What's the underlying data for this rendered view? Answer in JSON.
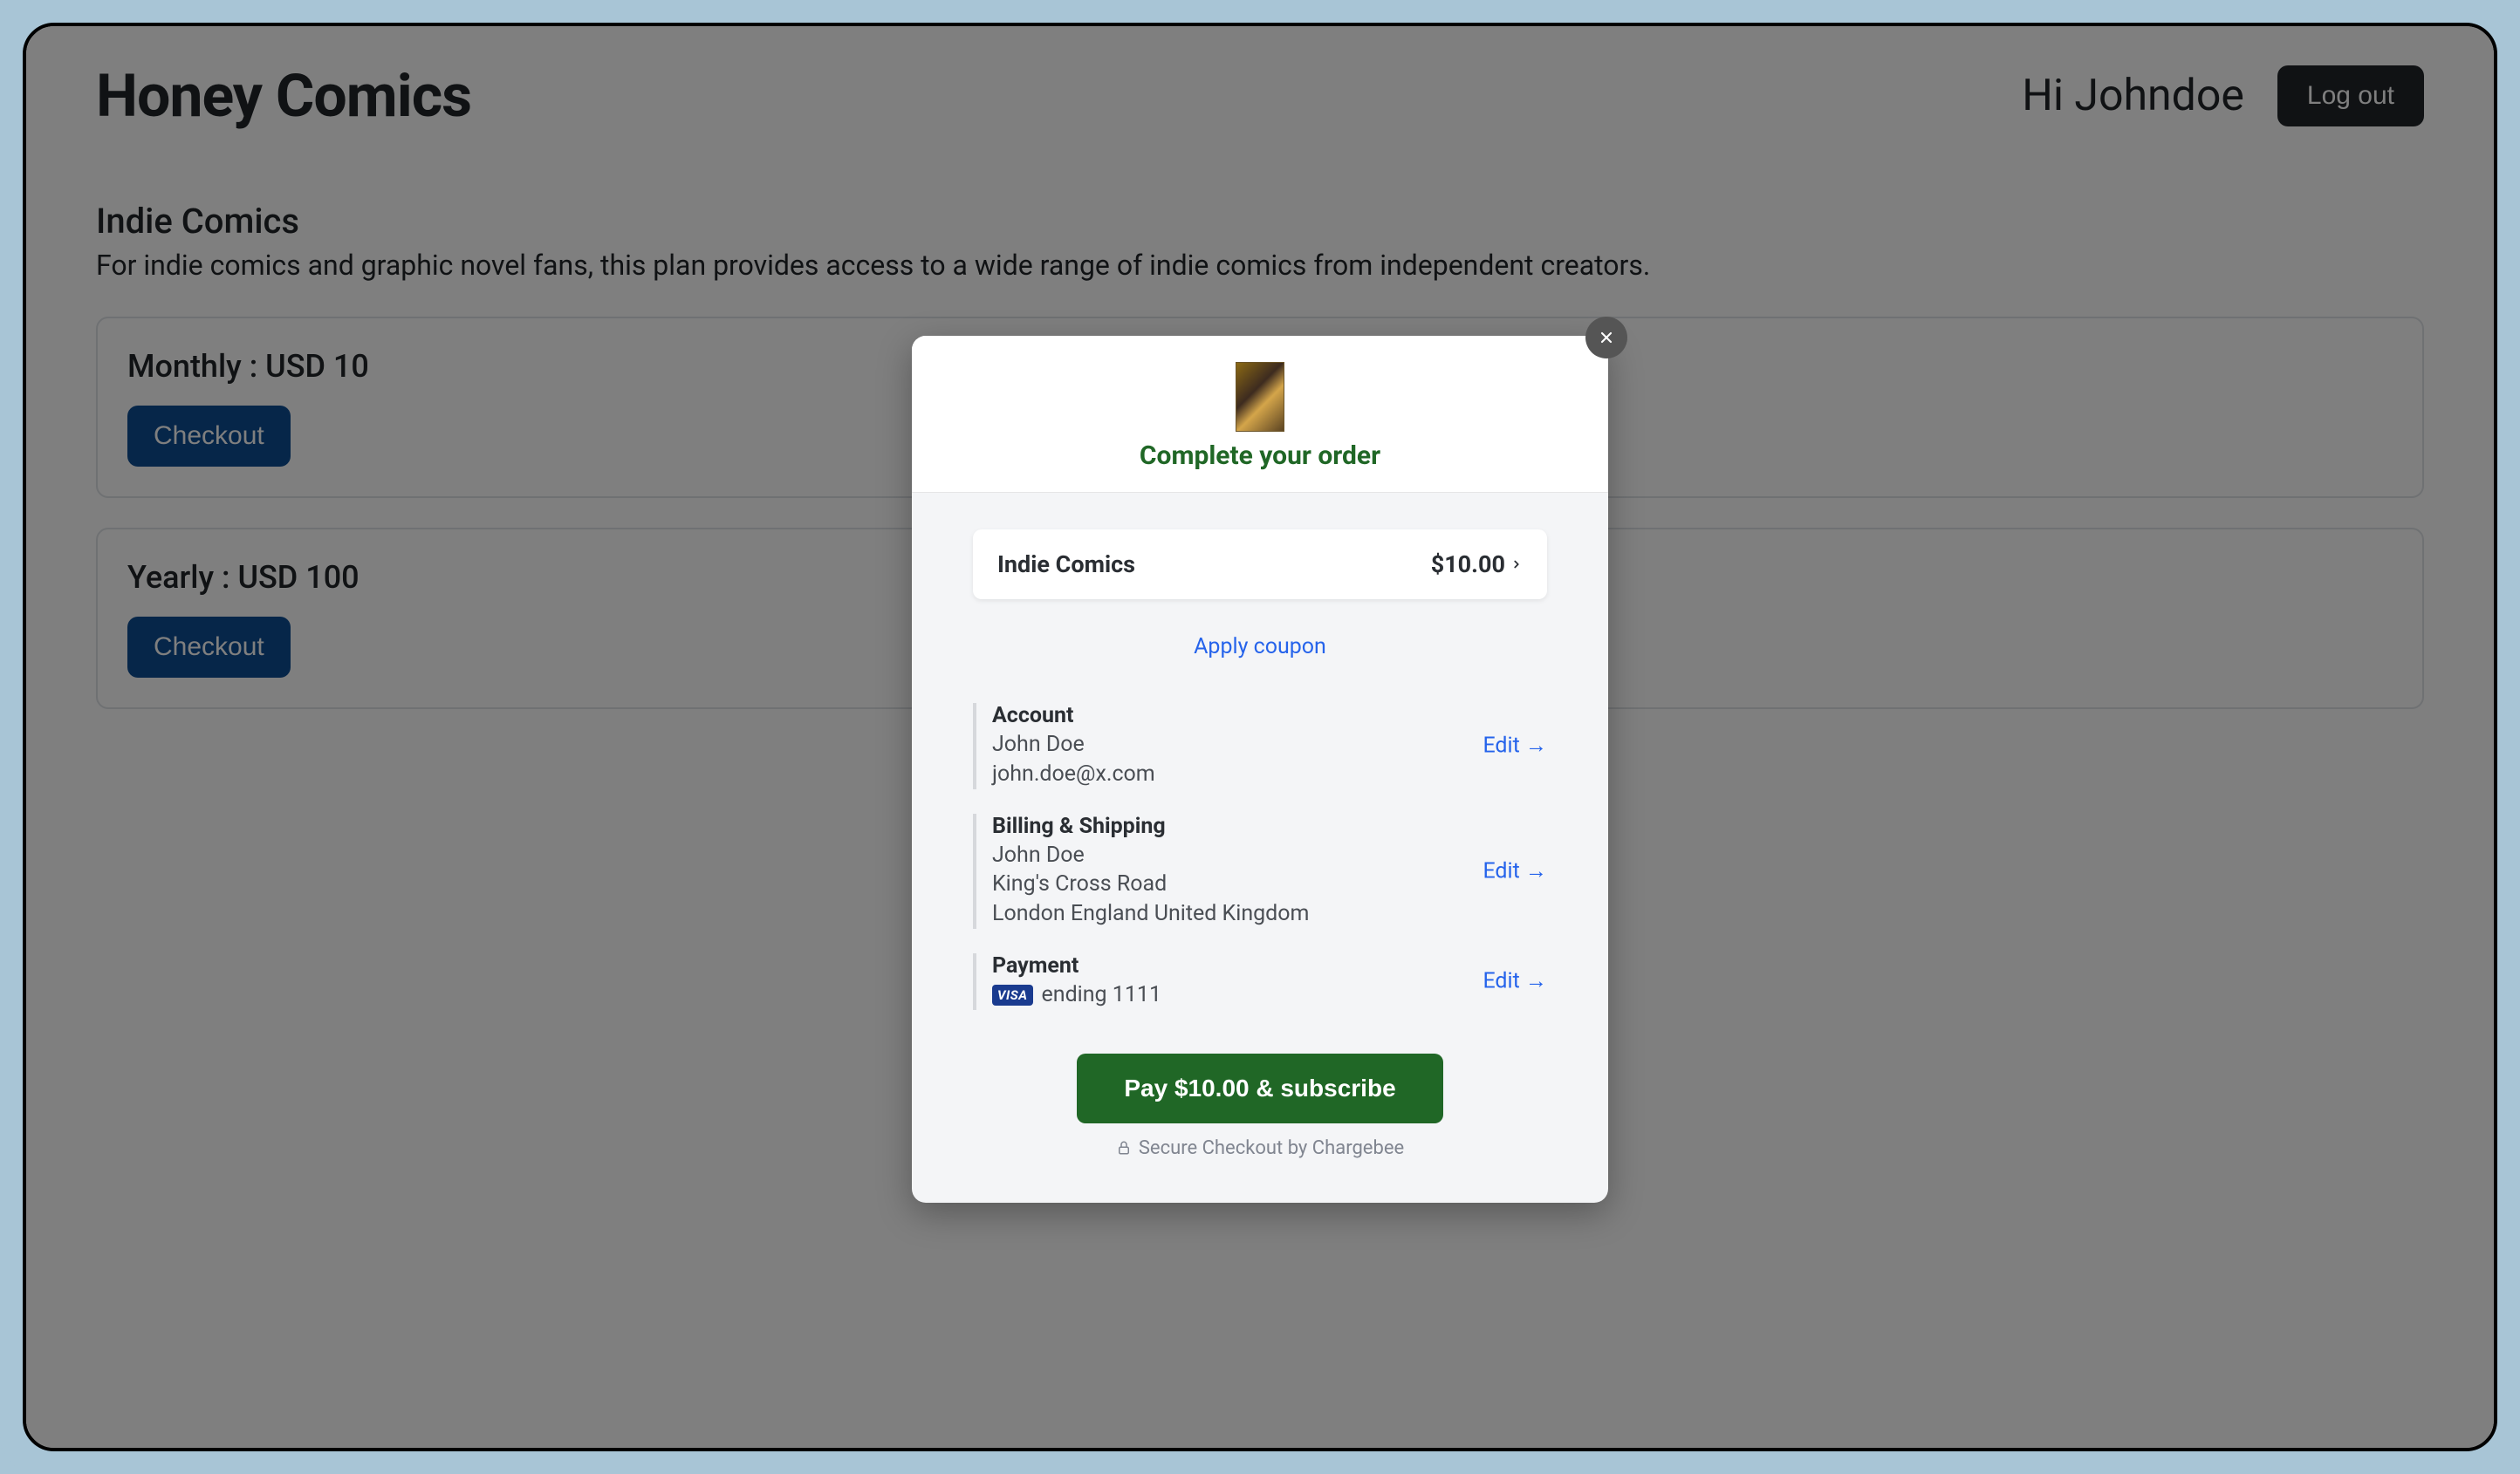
{
  "header": {
    "app_title": "Honey Comics",
    "greeting": "Hi Johndoe",
    "logout_label": "Log out"
  },
  "section": {
    "title": "Indie Comics",
    "description": "For indie comics and graphic novel fans, this plan provides access to a wide range of indie comics from independent creators."
  },
  "plans": {
    "monthly": {
      "title": "Monthly : USD 10",
      "checkout_label": "Checkout"
    },
    "yearly": {
      "title": "Yearly : USD 100",
      "checkout_label": "Checkout"
    }
  },
  "modal": {
    "title": "Complete your order",
    "product_name": "Indie Comics",
    "product_price": "$10.00",
    "apply_coupon": "Apply coupon",
    "account": {
      "label": "Account",
      "name": "John Doe",
      "email": "john.doe@x.com",
      "edit": "Edit →"
    },
    "billing": {
      "label": "Billing & Shipping",
      "name": "John Doe",
      "street": "King's Cross Road",
      "city": "London England United Kingdom",
      "edit": "Edit →"
    },
    "payment": {
      "label": "Payment",
      "card_brand": "VISA",
      "card_text": "ending 1111",
      "edit": "Edit →"
    },
    "pay_button": "Pay $10.00 & subscribe",
    "secure_text": "Secure Checkout by Chargebee"
  }
}
